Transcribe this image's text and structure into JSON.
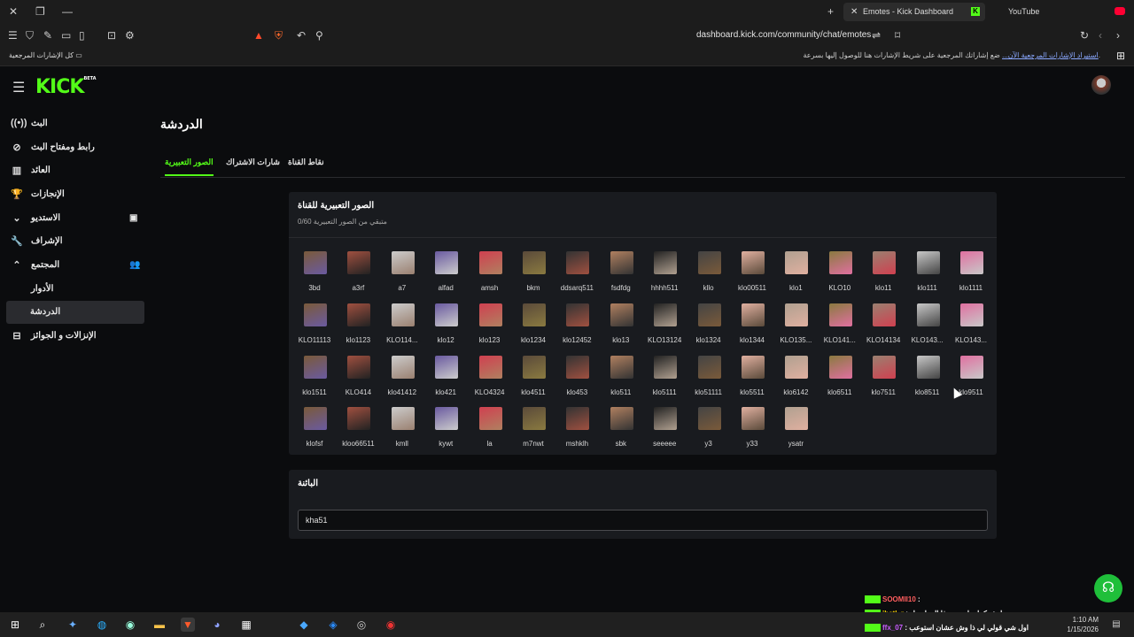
{
  "browser": {
    "tabs": [
      {
        "title": "Emotes - Kick Dashboard",
        "active": true
      },
      {
        "title": "YouTube",
        "active": false
      }
    ],
    "url": "dashboard.kick.com/community/chat/emotes",
    "bookmarks_left": "كل الإشارات المرجعية",
    "bookmarks_hint": "ضع إشاراتك المرجعية على شريط الإشارات هنا للوصول إليها بسرعة.",
    "bookmarks_link": "استيراد الإشارات المرجعية الآن..."
  },
  "app": {
    "brand": "KICK",
    "brand_tag": "BETA",
    "colors": {
      "accent": "#53fc18",
      "panel": "#191b1f",
      "bg": "#0b0c0e"
    }
  },
  "sidebar": {
    "items": [
      {
        "label": "البث",
        "icon": "broadcast-icon"
      },
      {
        "label": "رابط ومفتاح البث",
        "icon": "link-icon"
      },
      {
        "label": "العائد",
        "icon": "chart-icon"
      },
      {
        "label": "الإنجازات",
        "icon": "trophy-icon"
      },
      {
        "label": "الاستديو",
        "icon": "chevron-down-icon"
      },
      {
        "label": "الإشراف",
        "icon": "wrench-icon"
      },
      {
        "label": "المجتمع",
        "icon": "chevron-up-icon"
      },
      {
        "label": "الأدوار",
        "icon": ""
      },
      {
        "label": "الدردشة",
        "icon": ""
      },
      {
        "label": "الإنزالات و الجوائز",
        "icon": "gift-icon"
      }
    ]
  },
  "main": {
    "page_title": "الدردشة",
    "tabs": [
      "نقاط القناة",
      "شارات الاشتراك",
      "الصور التعبيرية"
    ],
    "active_tab": "الصور التعبيرية",
    "emotes_card": {
      "title": "الصور التعبيرية للقناة",
      "subtitle": "0/60 متبقي من الصور التعبيرية",
      "emotes": [
        "3bd",
        "a3rf",
        "a7",
        "alfad",
        "amsh",
        "bkm",
        "ddsarq511",
        "fsdfdg",
        "hhhh511",
        "kllo",
        "klo00511",
        "klo1",
        "KLO10",
        "klo11",
        "klo111",
        "klo1111",
        "KLO11113",
        "klo1123",
        "KLO114...",
        "klo12",
        "klo123",
        "klo1234",
        "klo12452",
        "klo13",
        "KLO13124",
        "klo1324",
        "klo1344",
        "KLO135...",
        "KLO141...",
        "KLO14134",
        "KLO143...",
        "KLO143...",
        "klo1511",
        "KLO414",
        "klo41412",
        "klo421",
        "KLO4324",
        "klo4511",
        "klo453",
        "klo511",
        "klo5111",
        "klo51111",
        "klo5511",
        "klo6142",
        "klo6511",
        "klo7511",
        "klo8511",
        "klo9511",
        "klofsf",
        "kloo66511",
        "kmll",
        "kywt",
        "la",
        "m7nwt",
        "mshklh",
        "sbk",
        "seeeee",
        "y3",
        "y33",
        "ysatr"
      ]
    },
    "banned_card": {
      "title": "البائنة",
      "input_value": "kha51"
    }
  },
  "chat_overlay": [
    {
      "user": "SOOMII10",
      "msg": ""
    },
    {
      "user": "ihetl_r",
      "msg": "ليش كملي ليه بس فا الي ارسل"
    },
    {
      "user": "ffx_07",
      "msg": "اول شي قولي لي ذا وش عشان استوعب"
    }
  ],
  "taskbar": {
    "time": "1:10 AM",
    "date": "1/15/2026"
  }
}
